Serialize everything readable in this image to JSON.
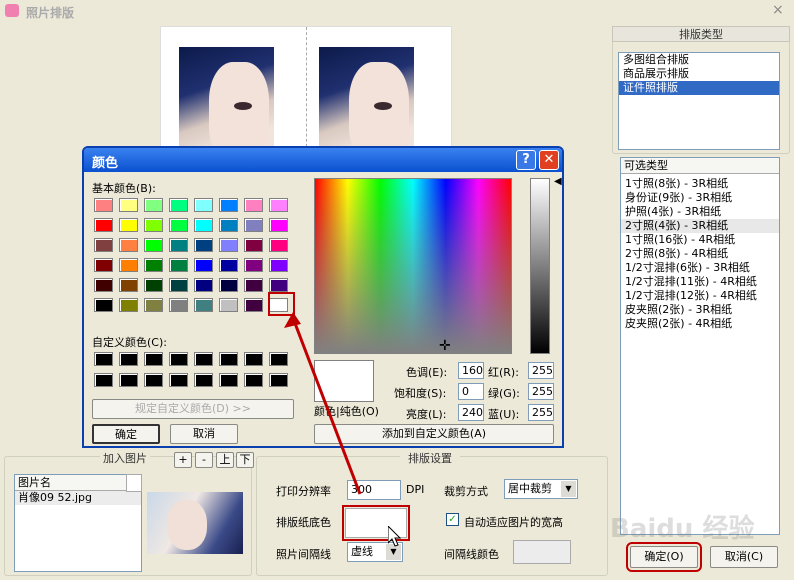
{
  "window": {
    "title": "照片排版",
    "close": "×"
  },
  "right": {
    "layout_type_title": "排版类型",
    "layout_types": [
      "多图组合排版",
      "商品展示排版",
      "证件照排版"
    ],
    "selected_layout": 2,
    "optional_title": "可选类型",
    "optional_items": [
      "1寸照(8张) - 3R相纸",
      "身份证(9张) - 3R相纸",
      "护照(4张) - 3R相纸",
      "2寸照(4张) - 3R相纸",
      "1寸照(16张) - 4R相纸",
      "2寸照(8张) - 4R相纸",
      "1/2寸混排(6张) - 3R相纸",
      "1/2寸混排(11张) - 4R相纸",
      "1/2寸混排(12张) - 4R相纸",
      "皮夹照(2张) - 3R相纸",
      "皮夹照(2张) - 4R相纸"
    ],
    "highlight_item": 3,
    "ok": "确定(O)",
    "cancel": "取消(C)"
  },
  "add_photo": {
    "title": "加入图片",
    "btn_add": "+",
    "btn_remove": "-",
    "btn_up": "上",
    "btn_down": "下",
    "col_name": "图片名",
    "files": [
      "肖像09 52.jpg"
    ]
  },
  "settings": {
    "title": "排版设置",
    "print_res_label": "打印分辨率",
    "print_res_value": "300",
    "dpi": "DPI",
    "crop_label": "裁剪方式",
    "crop_value": "居中裁剪",
    "paper_bg_label": "排版纸底色",
    "auto_fit_label": "自动适应图片的宽高",
    "auto_fit_checked": true,
    "spacing_label": "照片间隔线",
    "spacing_value": "虚线",
    "spacing_color_label": "间隔线颜色"
  },
  "color_dialog": {
    "title": "颜色",
    "help": "?",
    "close": "✕",
    "basic_label": "基本颜色(B):",
    "custom_label": "自定义颜色(C):",
    "define_custom": "规定自定义颜色(D) >>",
    "ok": "确定",
    "cancel": "取消",
    "color_solid": "颜色|纯色(O)",
    "add_custom": "添加到自定义颜色(A)",
    "hue_label": "色调(E):",
    "hue_value": "160",
    "sat_label": "饱和度(S):",
    "sat_value": "0",
    "lum_label": "亮度(L):",
    "lum_value": "240",
    "red_label": "红(R):",
    "red_value": "255",
    "green_label": "绿(G):",
    "green_value": "255",
    "blue_label": "蓝(U):",
    "blue_value": "255",
    "basic_colors": [
      [
        "#ff8080",
        "#ffff80",
        "#80ff80",
        "#00ff80",
        "#80ffff",
        "#0080ff",
        "#ff80c0",
        "#ff80ff"
      ],
      [
        "#ff0000",
        "#ffff00",
        "#80ff00",
        "#00ff40",
        "#00ffff",
        "#0080c0",
        "#8080c0",
        "#ff00ff"
      ],
      [
        "#804040",
        "#ff8040",
        "#00ff00",
        "#008080",
        "#004080",
        "#8080ff",
        "#800040",
        "#ff0080"
      ],
      [
        "#800000",
        "#ff8000",
        "#008000",
        "#008040",
        "#0000ff",
        "#0000a0",
        "#800080",
        "#8000ff"
      ],
      [
        "#400000",
        "#804000",
        "#004000",
        "#004040",
        "#000080",
        "#000040",
        "#400040",
        "#400080"
      ],
      [
        "#000000",
        "#808000",
        "#808040",
        "#808080",
        "#408080",
        "#c0c0c0",
        "#400040",
        "#ffffff"
      ]
    ],
    "custom_colors": [
      "#000000",
      "#000000",
      "#000000",
      "#000000",
      "#000000",
      "#000000",
      "#000000",
      "#000000",
      "#000000",
      "#000000",
      "#000000",
      "#000000",
      "#000000",
      "#000000",
      "#000000",
      "#000000"
    ]
  },
  "watermark": "Baidu 经验"
}
